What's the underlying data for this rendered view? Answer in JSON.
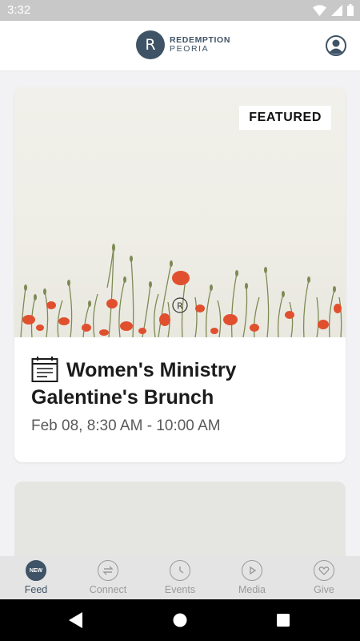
{
  "status_bar": {
    "time": "3:32"
  },
  "header": {
    "logo_mark": "R",
    "logo_line1": "REDEMPTION",
    "logo_line2": "PEORIA"
  },
  "feed": {
    "featured_card": {
      "badge": "FEATURED",
      "title": "Women's Ministry Galentine's Brunch",
      "date": "Feb 08, 8:30 AM - 10:00 AM",
      "image_watermark": "R"
    }
  },
  "tabs": [
    {
      "label": "Feed",
      "icon": "new-badge-icon",
      "badge": "NEW",
      "active": true
    },
    {
      "label": "Connect",
      "icon": "connect-arrows-icon",
      "active": false
    },
    {
      "label": "Events",
      "icon": "clock-icon",
      "active": false
    },
    {
      "label": "Media",
      "icon": "play-icon",
      "active": false
    },
    {
      "label": "Give",
      "icon": "heart-icon",
      "active": false
    }
  ],
  "colors": {
    "brand": "#3f5366",
    "inactive_tab": "#9a9a9a",
    "poppy": "#e0502f"
  }
}
